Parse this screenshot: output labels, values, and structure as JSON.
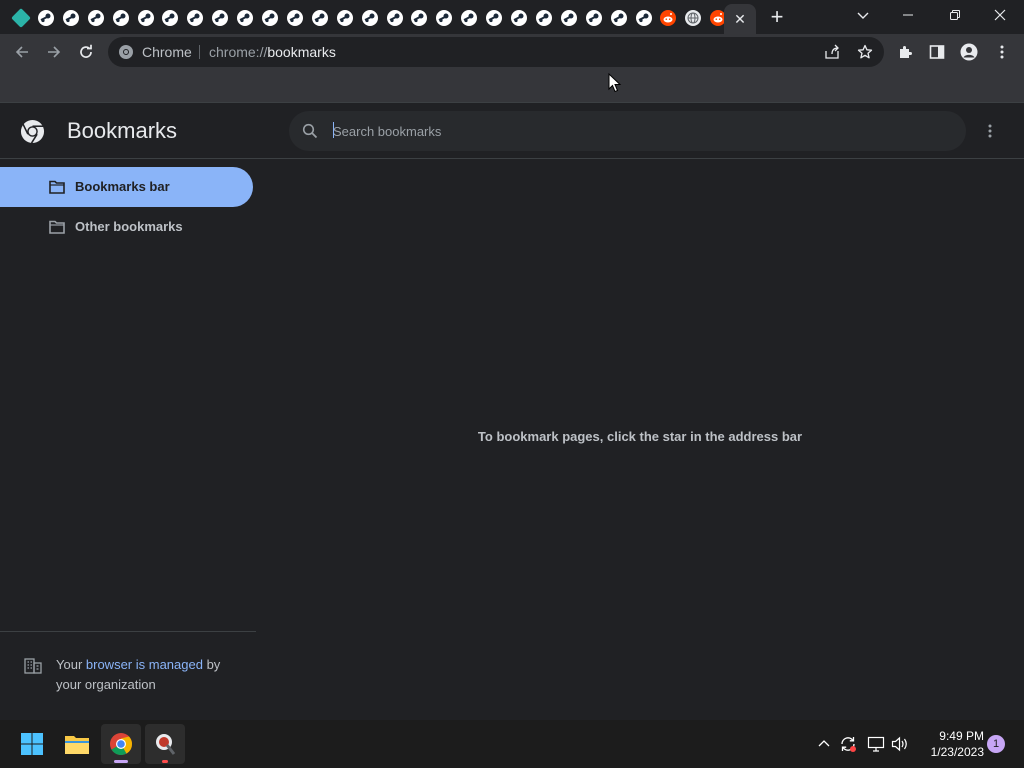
{
  "tabstrip": {
    "favicons": [
      "first-app-icon",
      "steam-icon",
      "steam-icon",
      "steam-icon",
      "steam-icon",
      "steam-icon",
      "steam-icon",
      "steam-icon",
      "steam-icon",
      "steam-icon",
      "steam-icon",
      "steam-icon",
      "steam-icon",
      "steam-icon",
      "steam-icon",
      "steam-icon",
      "steam-icon",
      "steam-icon",
      "steam-icon",
      "steam-icon",
      "steam-icon",
      "steam-icon",
      "steam-icon",
      "steam-icon",
      "steam-icon",
      "steam-icon",
      "reddit-icon",
      "globe-icon",
      "reddit-icon"
    ],
    "active_tab_close": "✕",
    "new_tab": "+"
  },
  "toolbar": {
    "omnibox_site": "Chrome",
    "omnibox_scheme": "chrome://",
    "omnibox_host": "bookmarks"
  },
  "page": {
    "title": "Bookmarks",
    "search_placeholder": "Search bookmarks",
    "empty_message": "To bookmark pages, click the star in the address bar"
  },
  "sidebar": {
    "items": [
      {
        "label": "Bookmarks bar",
        "selected": true
      },
      {
        "label": "Other bookmarks",
        "selected": false
      }
    ],
    "managed_prefix": "Your ",
    "managed_link": "browser is managed",
    "managed_suffix": " by your organization"
  },
  "taskbar": {
    "time": "9:49 PM",
    "date": "1/23/2023",
    "notification_count": "1"
  },
  "colors": {
    "accent": "#8ab4f8",
    "background": "#202124",
    "toolbar": "#35363a",
    "reddit": "#ff4500"
  }
}
